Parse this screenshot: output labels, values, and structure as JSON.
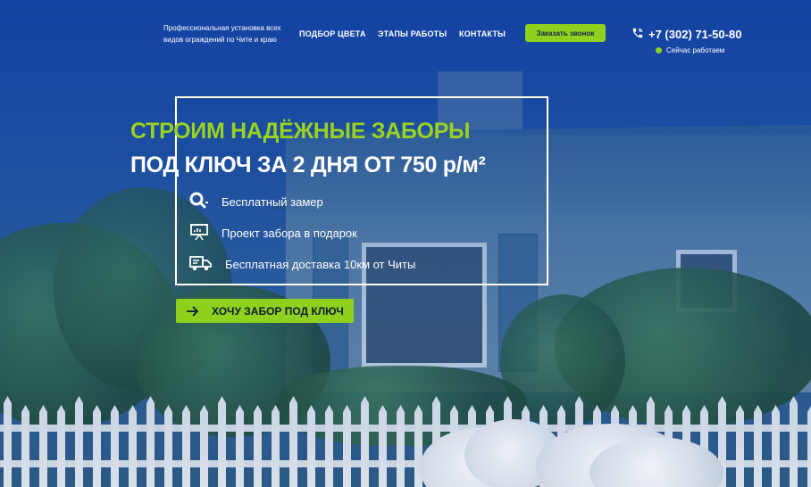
{
  "header": {
    "tagline": "Профессиональная установка всех видов ограждений по Чите и краю",
    "nav": [
      {
        "label": "ПОДБОР ЦВЕТА"
      },
      {
        "label": "ЭТАПЫ РАБОТЫ"
      },
      {
        "label": "КОНТАКТЫ"
      }
    ],
    "call_button": "Заказать звонок",
    "phone": "+7 (302) 71-50-80",
    "phone_icon": "phone-icon",
    "status": "Сейчас работаем",
    "status_color": "#8fd11c"
  },
  "hero": {
    "title_line1": "СТРОИМ НАДЁЖНЫЕ ЗАБОРЫ",
    "title_line2": "ПОД КЛЮЧ ЗА 2 ДНЯ ОТ 750 р/м²",
    "features": [
      {
        "icon": "search-icon",
        "text": "Бесплатный замер"
      },
      {
        "icon": "presentation-board-icon",
        "text": "Проект забора в подарок"
      },
      {
        "icon": "delivery-truck-icon",
        "text": "Бесплатная доставка 10км от Читы"
      }
    ],
    "cta": "ХОЧУ ЗАБОР ПОД КЛЮЧ",
    "cta_icon": "arrow-right-icon"
  },
  "colors": {
    "accent": "#8fd11c",
    "title_green": "#9ad21f",
    "primary_blue": "#1d4f9e"
  }
}
